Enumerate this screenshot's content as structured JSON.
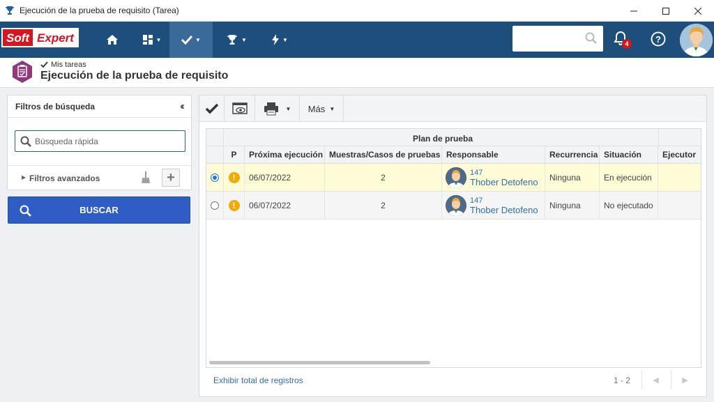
{
  "window": {
    "title": "Ejecución de la prueba de requisito (Tarea)",
    "controls": [
      "minimize",
      "maximize",
      "close"
    ]
  },
  "navbar": {
    "logo_soft": "Soft",
    "logo_expert": "Expert",
    "items": [
      {
        "icon": "home-icon"
      },
      {
        "icon": "dashboard-icon"
      },
      {
        "icon": "check-icon",
        "active": true
      },
      {
        "icon": "trophy-icon"
      },
      {
        "icon": "lightning-icon"
      }
    ],
    "search_placeholder": "",
    "notifications_count": "4"
  },
  "header": {
    "breadcrumb": "Mis tareas",
    "title": "Ejecución de la prueba de requisito"
  },
  "filters": {
    "title": "Filtros de búsqueda",
    "quick_search_placeholder": "Búsqueda rápida",
    "advanced": "Filtros avanzados",
    "search_button": "BUSCAR"
  },
  "toolbar": {
    "more_label": "Más"
  },
  "grid": {
    "group_header": "Plan de prueba",
    "columns": [
      "P",
      "Próxima ejecución",
      "Muestras/Casos de pruebas",
      "Responsable",
      "Recurrencia",
      "Situación",
      "Ejecutor"
    ],
    "rows": [
      {
        "selected": true,
        "next_run": "06/07/2022",
        "samples": "2",
        "resp_id": "147",
        "resp_name": "Thober Detofeno",
        "recurrence": "Ninguna",
        "status": "En ejecución",
        "executor": ""
      },
      {
        "selected": false,
        "next_run": "06/07/2022",
        "samples": "2",
        "resp_id": "147",
        "resp_name": "Thober Detofeno",
        "recurrence": "Ninguna",
        "status": "No ejecutado",
        "executor": ""
      }
    ]
  },
  "footer": {
    "show_total": "Exhibir total de registros",
    "range": "1 - 2"
  },
  "colors": {
    "navbar": "#1e4e7c",
    "accent_button": "#2e5ec5",
    "selected_row": "#fdfcd6",
    "warning": "#f2a900",
    "brand_red": "#d5151f"
  }
}
